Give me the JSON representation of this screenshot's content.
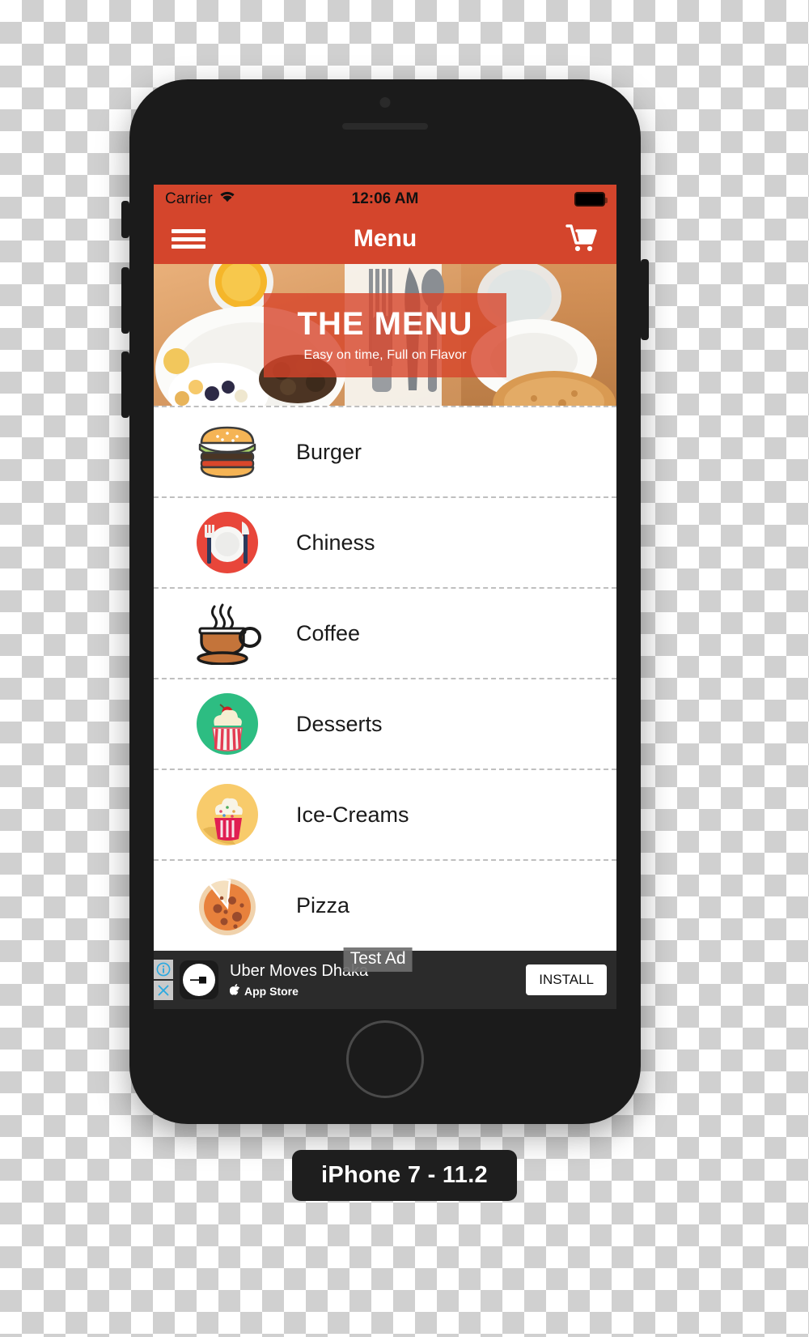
{
  "colors": {
    "brand_red": "#d4452c",
    "hero_overlay": "rgba(215,69,43,0.80)",
    "screen_bg": "#ffffff",
    "ad_bg": "#2b2b2b",
    "phone_body": "#1b1b1b"
  },
  "status_bar": {
    "carrier": "Carrier",
    "wifi_icon": "wifi-icon",
    "time": "12:06 AM",
    "battery_icon": "battery-full-icon"
  },
  "nav_bar": {
    "menu_icon": "hamburger-menu-icon",
    "title": "Menu",
    "cart_icon": "shopping-cart-icon"
  },
  "hero": {
    "title": "THE MENU",
    "subtitle": "Easy on time, Full on Flavor",
    "image_alt": "breakfast-table-photo"
  },
  "menu_items": [
    {
      "label": "Burger",
      "icon": "burger-icon"
    },
    {
      "label": "Chiness",
      "icon": "chinese-plate-icon"
    },
    {
      "label": "Coffee",
      "icon": "coffee-cup-icon"
    },
    {
      "label": "Desserts",
      "icon": "cupcake-green-icon"
    },
    {
      "label": "Ice-Creams",
      "icon": "cupcake-yellow-icon"
    },
    {
      "label": "Pizza",
      "icon": "pizza-icon"
    }
  ],
  "ad": {
    "badge": "Test Ad",
    "headline": "Uber Moves Dhaka",
    "store": "App Store",
    "store_icon": "apple-logo-icon",
    "install_label": "INSTALL",
    "info_icon": "info-icon",
    "close_icon": "close-icon",
    "logo_icon": "uber-logo-icon"
  },
  "device": {
    "label": "iPhone 7 - 11.2"
  }
}
